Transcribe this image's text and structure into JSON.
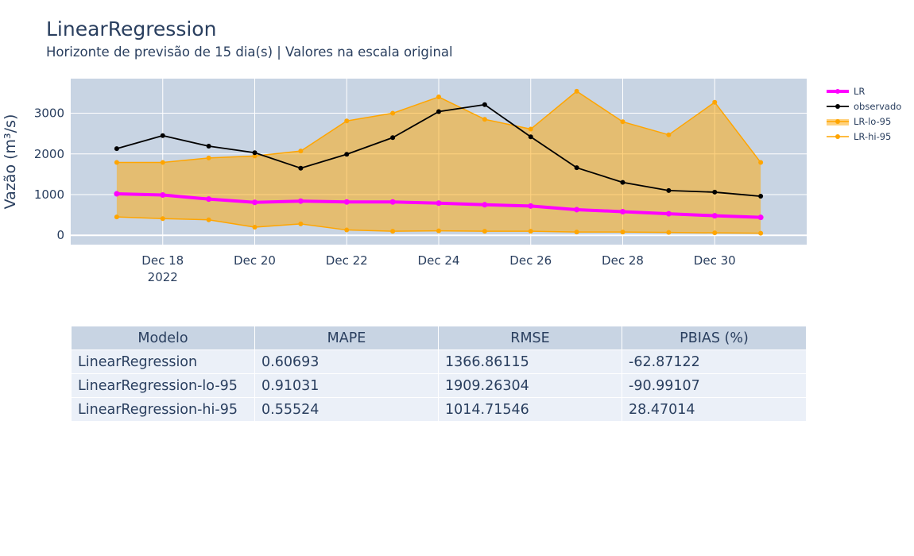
{
  "title": "LinearRegression",
  "subtitle": "Horizonte de previsão de 15 dia(s) | Valores na escala original",
  "colors": {
    "plot_bg": "#c8d4e3",
    "grid": "#ffffff",
    "lr": "#ff00ff",
    "observed": "#000000",
    "band": "#ffa500",
    "band_fill": "rgba(255,165,0,0.5)",
    "text": "#2a3f5f"
  },
  "chart_data": {
    "type": "line",
    "title": "LinearRegression",
    "subtitle": "Horizonte de previsão de 15 dia(s) | Valores na escala original",
    "xlabel": "",
    "ylabel": "Vazão (m³/s)",
    "x": [
      "2022-12-17",
      "2022-12-18",
      "2022-12-19",
      "2022-12-20",
      "2022-12-21",
      "2022-12-22",
      "2022-12-23",
      "2022-12-24",
      "2022-12-25",
      "2022-12-26",
      "2022-12-27",
      "2022-12-28",
      "2022-12-29",
      "2022-12-30",
      "2022-12-31"
    ],
    "x_ticks": [
      {
        "date": "2022-12-18",
        "label": "Dec 18",
        "sublabel": "2022"
      },
      {
        "date": "2022-12-20",
        "label": "Dec 20",
        "sublabel": ""
      },
      {
        "date": "2022-12-22",
        "label": "Dec 22",
        "sublabel": ""
      },
      {
        "date": "2022-12-24",
        "label": "Dec 24",
        "sublabel": ""
      },
      {
        "date": "2022-12-26",
        "label": "Dec 26",
        "sublabel": ""
      },
      {
        "date": "2022-12-28",
        "label": "Dec 28",
        "sublabel": ""
      },
      {
        "date": "2022-12-30",
        "label": "Dec 30",
        "sublabel": ""
      }
    ],
    "xlim": [
      "2022-12-16",
      "2023-01-01"
    ],
    "ylim": [
      -230,
      3850
    ],
    "y_ticks": [
      0,
      1000,
      2000,
      3000
    ],
    "grid": true,
    "legend_position": "right",
    "series": [
      {
        "name": "LR",
        "role": "forecast",
        "values": [
          1020,
          990,
          890,
          810,
          840,
          820,
          820,
          790,
          750,
          720,
          630,
          580,
          530,
          480,
          440
        ]
      },
      {
        "name": "observado",
        "role": "observed",
        "values": [
          2130,
          2450,
          2190,
          2030,
          1650,
          1990,
          2400,
          3040,
          3210,
          2420,
          1660,
          1300,
          1100,
          1060,
          960
        ]
      },
      {
        "name": "LR-lo-95",
        "role": "band-low",
        "values": [
          450,
          410,
          380,
          200,
          280,
          130,
          100,
          110,
          100,
          100,
          80,
          80,
          70,
          60,
          50
        ]
      },
      {
        "name": "LR-hi-95",
        "role": "band-high",
        "values": [
          1790,
          1790,
          1900,
          1950,
          2070,
          2810,
          3000,
          3400,
          2850,
          2610,
          3540,
          2790,
          2470,
          3270,
          1790
        ]
      }
    ]
  },
  "table": {
    "columns": [
      "Modelo",
      "MAPE",
      "RMSE",
      "PBIAS (%)"
    ],
    "rows": [
      [
        "LinearRegression",
        "0.60693",
        "1366.86115",
        "-62.87122"
      ],
      [
        "LinearRegression-lo-95",
        "0.91031",
        "1909.26304",
        "-90.99107"
      ],
      [
        "LinearRegression-hi-95",
        "0.55524",
        "1014.71546",
        "28.47014"
      ]
    ]
  }
}
